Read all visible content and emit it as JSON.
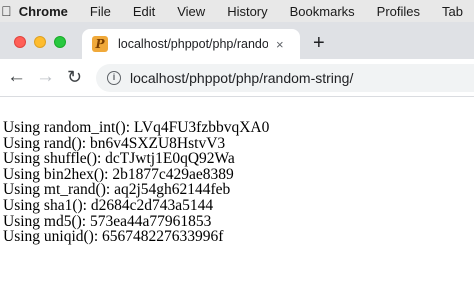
{
  "menubar": {
    "app_name": "Chrome",
    "items": [
      "File",
      "Edit",
      "View",
      "History",
      "Bookmarks",
      "Profiles",
      "Tab"
    ]
  },
  "tab": {
    "favicon_letter": "P",
    "title": "localhost/phppot/php/random-",
    "close_glyph": "×"
  },
  "toolbar": {
    "new_tab_glyph": "+",
    "url": "localhost/phppot/php/random-string/"
  },
  "content": {
    "lines": [
      "Using random_int(): LVq4FU3fzbbvqXA0",
      "Using rand(): bn6v4SXZU8HstvV3",
      "Using shuffle(): dcTJwtj1E0qQ92Wa",
      "Using bin2hex(): 2b1877c429ae8389",
      "Using mt_rand(): aq2j54gh62144feb",
      "Using sha1(): d2684c2d743a5144",
      "Using md5(): 573ea44a77961853",
      "Using uniqid(): 656748227633996f"
    ]
  }
}
